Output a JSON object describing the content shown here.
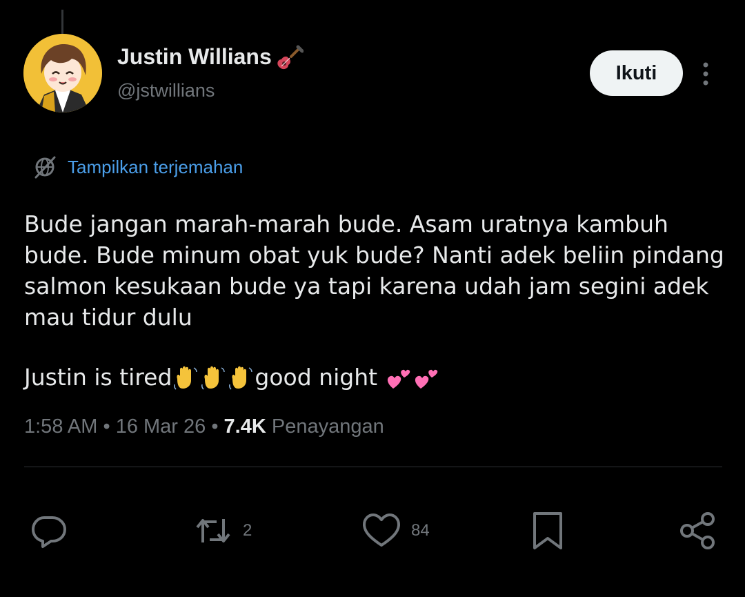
{
  "author": {
    "display_name": "Justin Willians",
    "name_emoji": "guitar-emoji",
    "handle": "@jstwillians",
    "avatar": "cartoon-character-avatar"
  },
  "follow_button": {
    "label": "Ikuti"
  },
  "translate": {
    "label": "Tampilkan terjemahan",
    "icon": "globe-translate-icon"
  },
  "tweet": {
    "paragraph1": "Bude jangan marah-marah bude. Asam uratnya kambuh bude. Bude minum obat yuk bude? Nanti adek beliin pindang salmon kesukaan bude ya tapi karena udah jam segini adek mau tidur dulu",
    "paragraph2_text_a": "Justin is tired",
    "paragraph2_emojis_a": [
      "waving-hand-emoji",
      "waving-hand-emoji",
      "waving-hand-emoji"
    ],
    "paragraph2_text_b": "good night ",
    "paragraph2_emojis_b": [
      "two-hearts-emoji",
      "two-hearts-emoji"
    ]
  },
  "meta": {
    "time": "1:58 AM",
    "separator": "•",
    "date": "16 Mar 26",
    "views_count": "7.4K",
    "views_label": "Penayangan"
  },
  "actions": {
    "reply": {
      "icon": "reply-icon",
      "count": ""
    },
    "retweet": {
      "icon": "retweet-icon",
      "count": "2"
    },
    "like": {
      "icon": "heart-icon",
      "count": "84"
    },
    "bookmark": {
      "icon": "bookmark-icon",
      "count": ""
    },
    "share": {
      "icon": "share-icon",
      "count": ""
    }
  },
  "colors": {
    "background": "#000000",
    "text_primary": "#e7e9ea",
    "text_secondary": "#71767b",
    "link_blue": "#4b9fea",
    "button_bg": "#eff3f4",
    "divider": "#2f3336",
    "avatar_bg": "#f2c037"
  }
}
